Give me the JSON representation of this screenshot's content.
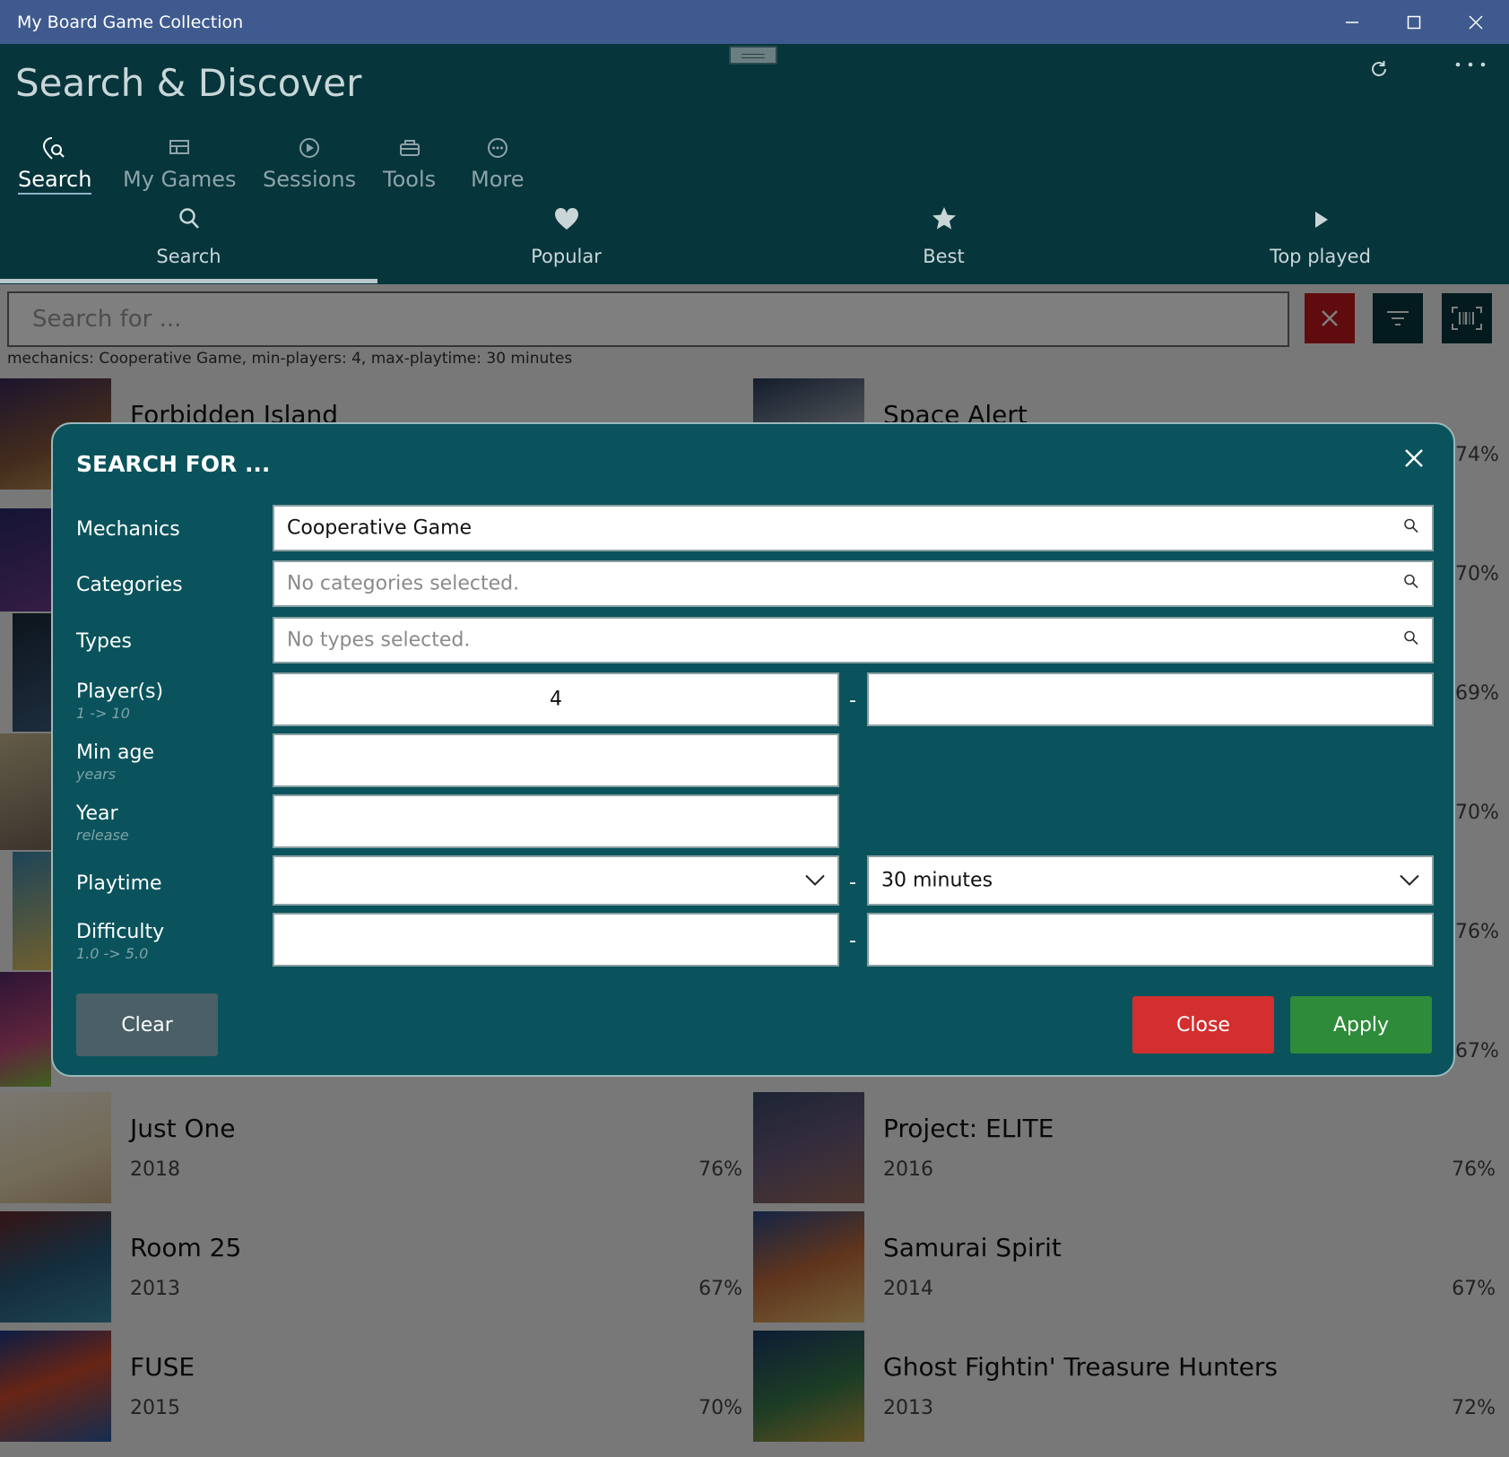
{
  "window": {
    "title": "My Board Game Collection"
  },
  "header": {
    "page_title": "Search & Discover",
    "nav_tabs": [
      {
        "label": "Search",
        "icon": "search-location-icon"
      },
      {
        "label": "My Games",
        "icon": "collection-icon"
      },
      {
        "label": "Sessions",
        "icon": "play-circle-icon"
      },
      {
        "label": "Tools",
        "icon": "toolbox-icon"
      },
      {
        "label": "More",
        "icon": "more-circle-icon"
      }
    ],
    "sub_tabs": [
      {
        "label": "Search",
        "icon": "search-icon"
      },
      {
        "label": "Popular",
        "icon": "heart-icon"
      },
      {
        "label": "Best",
        "icon": "star-icon"
      },
      {
        "label": "Top played",
        "icon": "play-icon"
      }
    ]
  },
  "search": {
    "placeholder": "Search for ...",
    "filter_summary": "mechanics: Cooperative Game, min-players: 4, max-playtime: 30 minutes"
  },
  "games_left": [
    {
      "name": "Forbidden Island",
      "year": "",
      "pct": ""
    },
    {
      "name": "Just One",
      "year": "2018",
      "pct": "76%"
    },
    {
      "name": "Room 25",
      "year": "2013",
      "pct": "67%"
    },
    {
      "name": "FUSE",
      "year": "2015",
      "pct": "70%"
    }
  ],
  "games_right": [
    {
      "name": "Space Alert",
      "year": "",
      "pct": ""
    },
    {
      "name": "Project: ELITE",
      "year": "2016",
      "pct": "76%"
    },
    {
      "name": "Samurai Spirit",
      "year": "2014",
      "pct": "67%"
    },
    {
      "name": "Ghost Fightin' Treasure Hunters",
      "year": "2013",
      "pct": "72%"
    }
  ],
  "side_pcts": [
    "74%",
    "70%",
    "69%",
    "70%",
    "76%",
    "67%"
  ],
  "dialog": {
    "title": "SEARCH FOR ...",
    "mechanics": {
      "label": "Mechanics",
      "value": "Cooperative Game"
    },
    "categories": {
      "label": "Categories",
      "placeholder": "No categories selected."
    },
    "types": {
      "label": "Types",
      "placeholder": "No types selected."
    },
    "players": {
      "label": "Player(s)",
      "sub": "1 -> 10",
      "min": "4",
      "max": ""
    },
    "min_age": {
      "label": "Min age",
      "sub": "years",
      "value": ""
    },
    "year": {
      "label": "Year",
      "sub": "release",
      "value": ""
    },
    "playtime": {
      "label": "Playtime",
      "min": "",
      "max": "30 minutes"
    },
    "difficulty": {
      "label": "Difficulty",
      "sub": "1.0 -> 5.0",
      "min": "",
      "max": ""
    },
    "range_sep": "-",
    "clear_label": "Clear",
    "close_label": "Close",
    "apply_label": "Apply"
  },
  "colors": {
    "titlebar": "#3f5a8e",
    "header": "#06353c",
    "dialog": "#0a535c",
    "clear_button": "#4a5f66",
    "close_button": "#d32f2f",
    "apply_button": "#2e8b3a",
    "clear_search_button": "#c0181e"
  }
}
